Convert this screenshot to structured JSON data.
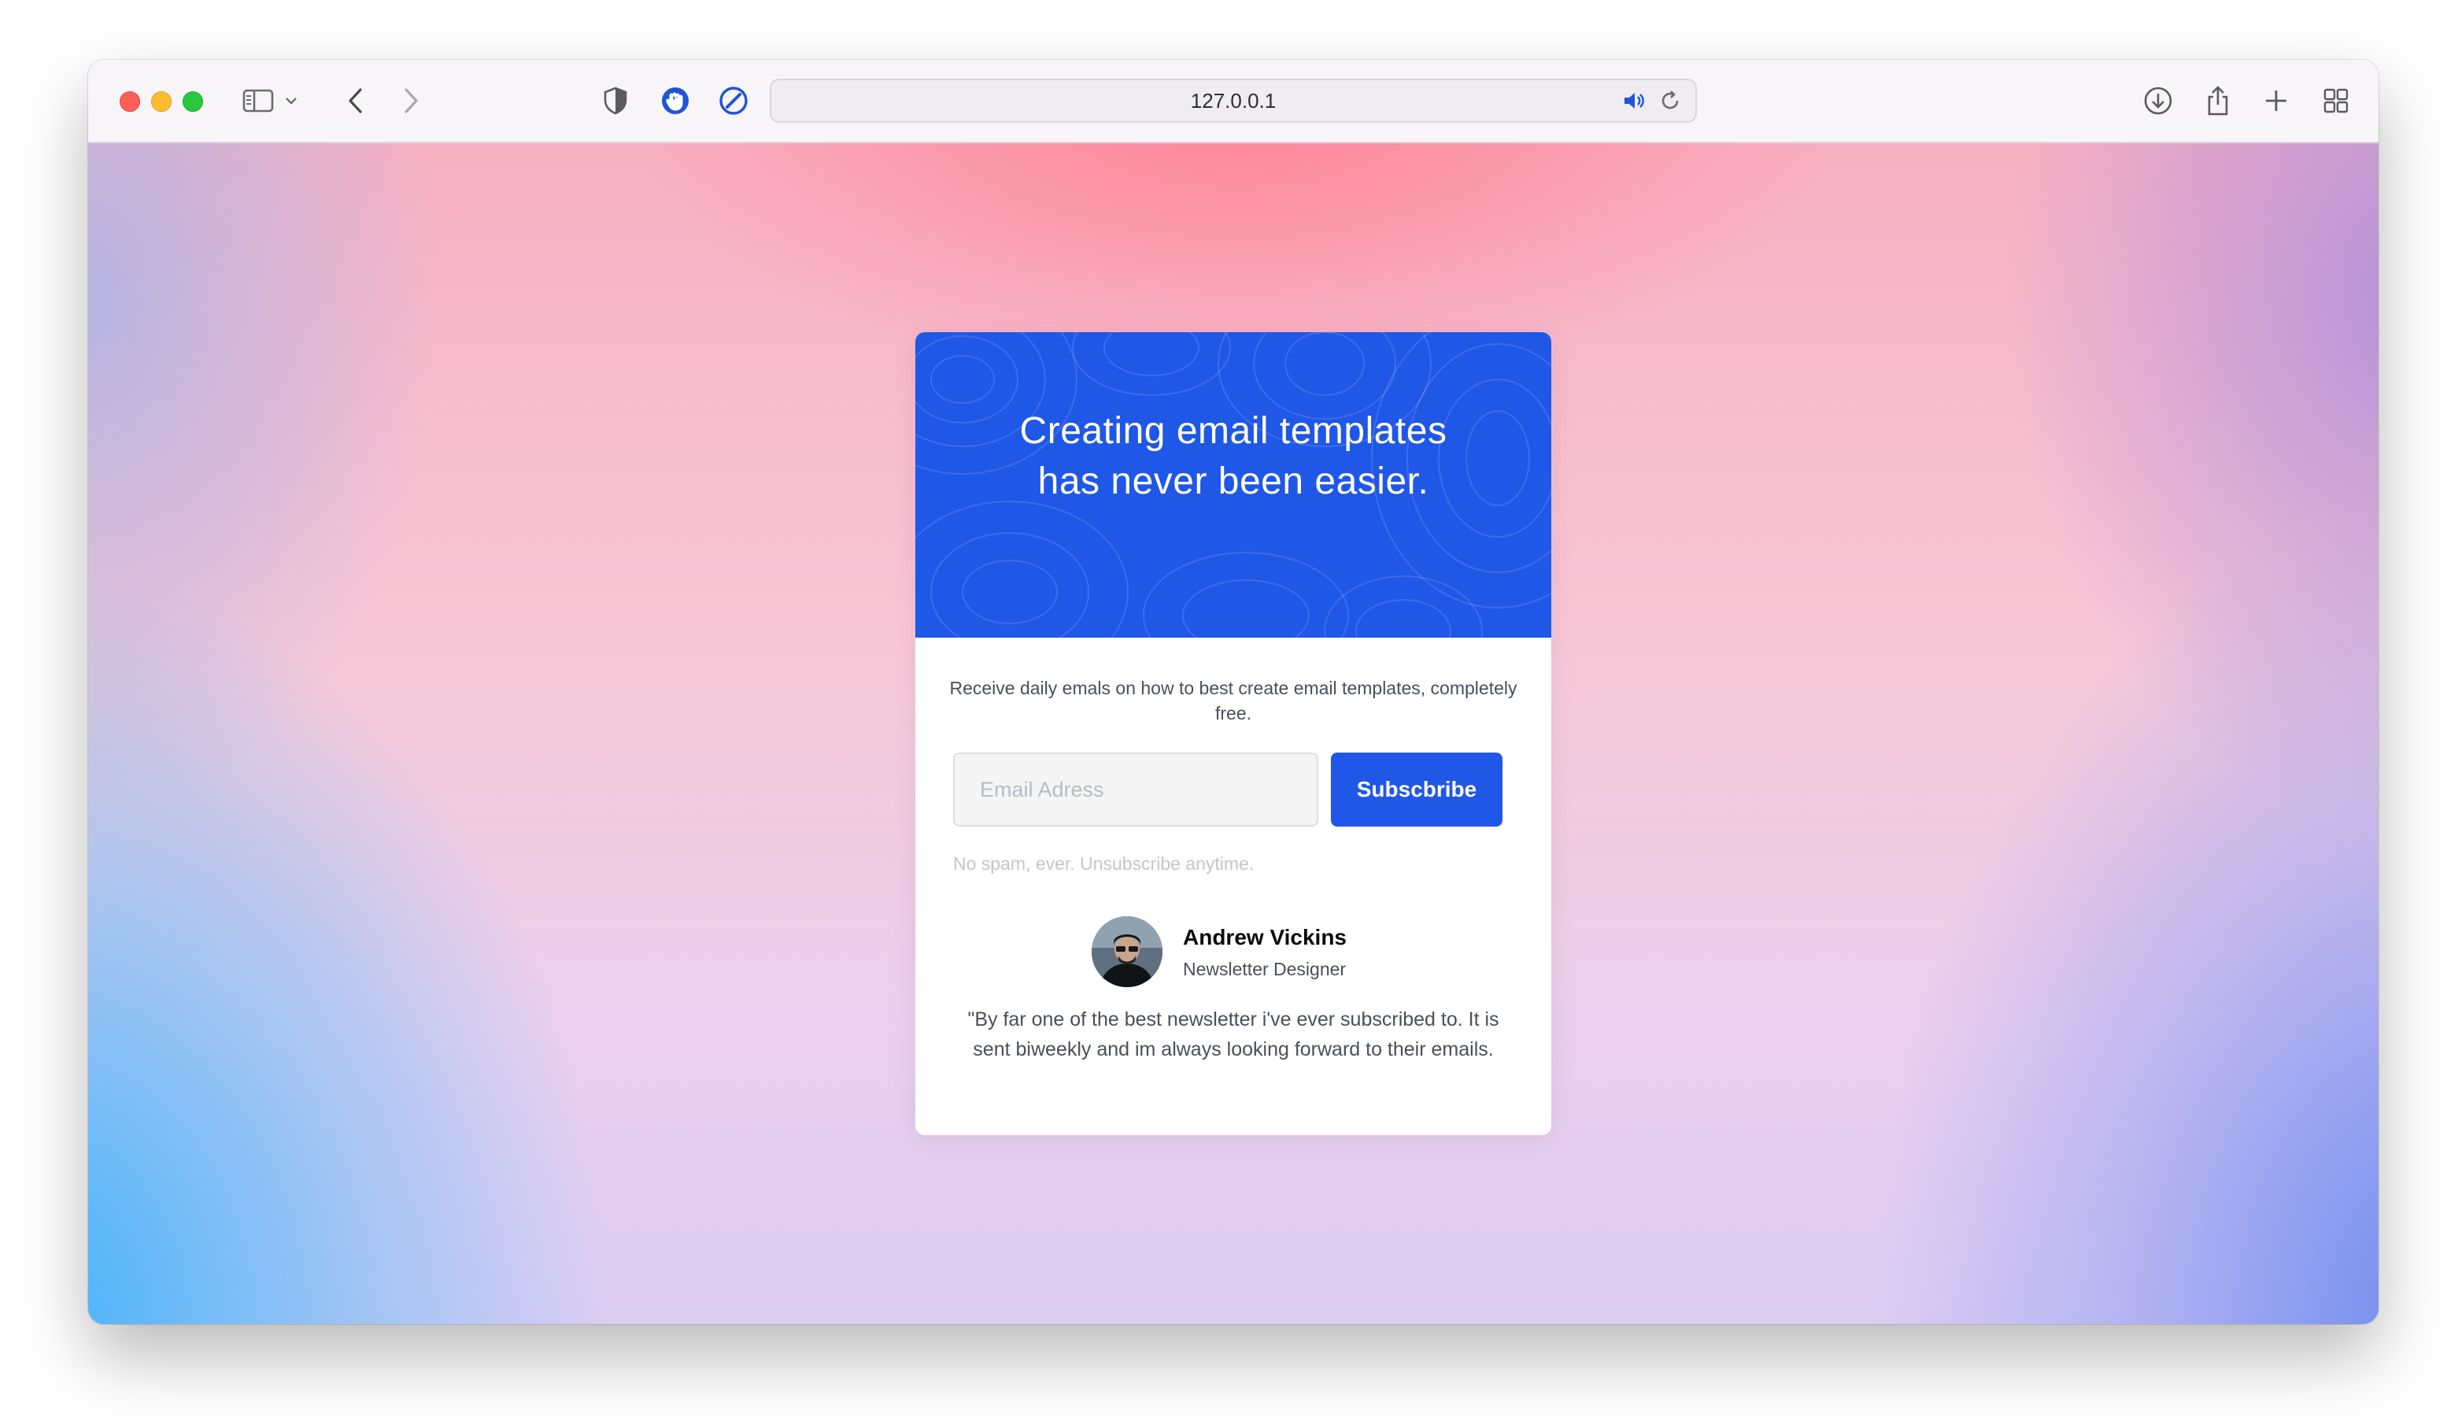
{
  "browser": {
    "url": "127.0.0.1",
    "icons": {
      "sidebar": "sidebar-icon",
      "back": "chevron-left-icon",
      "forward": "chevron-right-icon",
      "shield": "shield-icon",
      "extension1": "hand-icon",
      "extension2": "compass-icon",
      "audio": "speaker-icon",
      "reload": "reload-icon",
      "download": "download-icon",
      "share": "share-icon",
      "new_tab": "plus-icon",
      "tabs": "tab-overview-icon"
    }
  },
  "card": {
    "title": "Creating email templates has never been easier.",
    "description": "Receive daily emals on how to best create email templates, completely free.",
    "email_placeholder": "Email Adress",
    "email_value": "",
    "subscribe_label": "Subscbribe",
    "no_spam": "No spam, ever. Unsubscribe anytime.",
    "author_name": "Andrew Vickins",
    "author_role": "Newsletter Designer",
    "quote": "\"By far one of the best newsletter i've ever subscribed to. It is sent biweekly and im always looking forward to their emails."
  },
  "colors": {
    "accent": "#1f57e7",
    "text_muted": "#4a4f5c",
    "text_faint": "#c4c6cd"
  }
}
